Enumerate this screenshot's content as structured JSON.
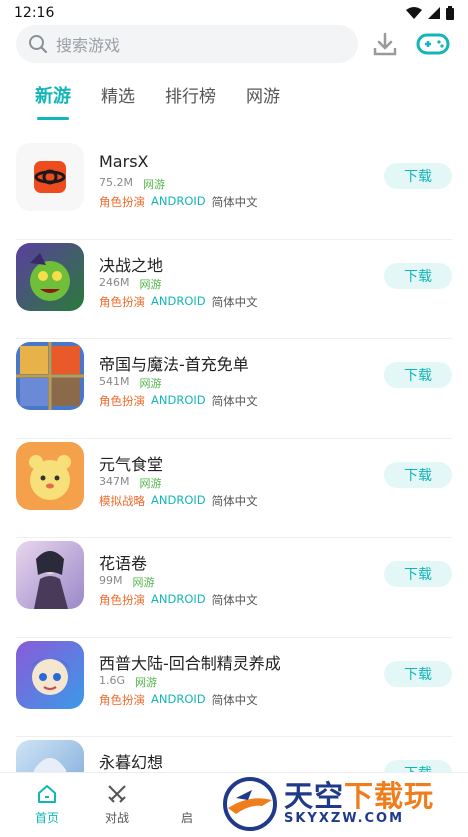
{
  "status": {
    "time": "12:16"
  },
  "search": {
    "placeholder": "搜索游戏"
  },
  "tabs": [
    {
      "label": "新游"
    },
    {
      "label": "精选"
    },
    {
      "label": "排行榜"
    },
    {
      "label": "网游"
    }
  ],
  "games": [
    {
      "name": "MarsX",
      "size": "75.2M",
      "type": "网游",
      "genre": "角色扮演",
      "platform": "ANDROID",
      "lang": "简体中文",
      "btn": "下载"
    },
    {
      "name": "决战之地",
      "size": "246M",
      "type": "网游",
      "genre": "角色扮演",
      "platform": "ANDROID",
      "lang": "简体中文",
      "btn": "下载"
    },
    {
      "name": "帝国与魔法-首充免单",
      "size": "541M",
      "type": "网游",
      "genre": "角色扮演",
      "platform": "ANDROID",
      "lang": "简体中文",
      "btn": "下载"
    },
    {
      "name": "元气食堂",
      "size": "347M",
      "type": "网游",
      "genre": "模拟战略",
      "platform": "ANDROID",
      "lang": "简体中文",
      "btn": "下载"
    },
    {
      "name": "花语卷",
      "size": "99M",
      "type": "网游",
      "genre": "角色扮演",
      "platform": "ANDROID",
      "lang": "简体中文",
      "btn": "下载"
    },
    {
      "name": "西普大陆-回合制精灵养成",
      "size": "1.6G",
      "type": "网游",
      "genre": "角色扮演",
      "platform": "ANDROID",
      "lang": "简体中文",
      "btn": "下载"
    },
    {
      "name": "永暮幻想",
      "size": "",
      "type": "",
      "genre": "",
      "platform": "",
      "lang": "",
      "btn": "下载"
    }
  ],
  "bottom_nav": [
    {
      "label": "首页",
      "icon": "home-icon"
    },
    {
      "label": "对战",
      "icon": "swords-icon"
    },
    {
      "label": "启",
      "icon": "launch-icon"
    }
  ],
  "watermark": {
    "main_a": "天空",
    "main_b": "下载玩",
    "sub": "SKYXZW.COM"
  },
  "colors": {
    "accent": "#13b6b8",
    "genre": "#f06a2b",
    "net": "#52b54b"
  }
}
